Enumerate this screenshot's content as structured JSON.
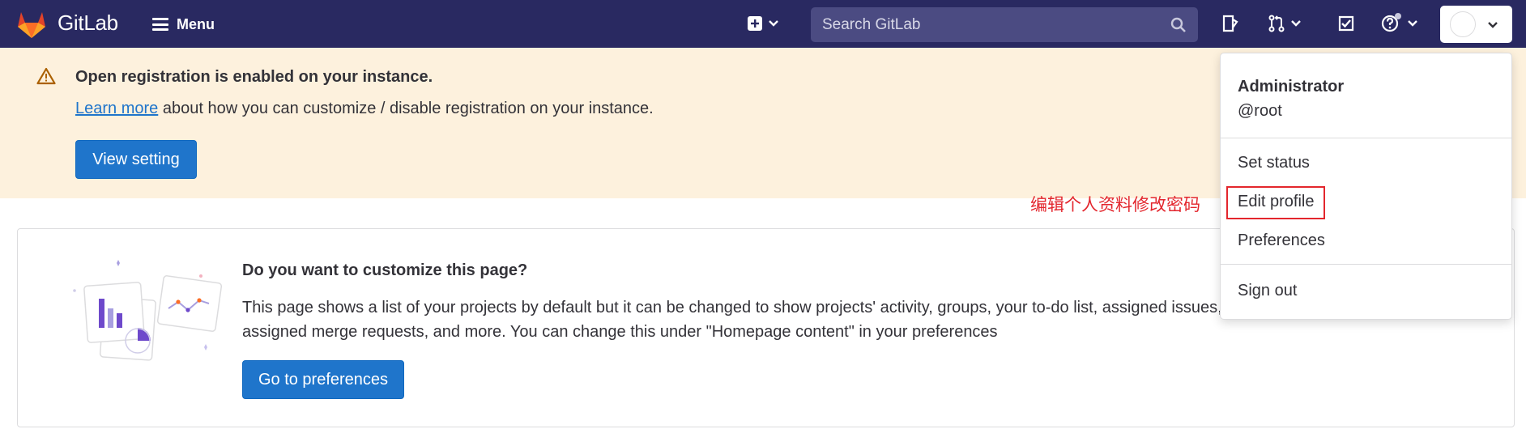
{
  "navbar": {
    "brand": "GitLab",
    "menu_label": "Menu",
    "search_placeholder": "Search GitLab"
  },
  "banner": {
    "title": "Open registration is enabled on your instance.",
    "learn_more_link": "Learn more",
    "text_rest": " about how you can customize / disable registration on your instance.",
    "button_label": "View setting"
  },
  "card": {
    "title": "Do you want to customize this page?",
    "text": "This page shows a list of your projects by default but it can be changed to show projects' activity, groups, your to-do list, assigned issues, assigned merge requests, and more. You can change this under \"Homepage content\" in your preferences",
    "button_label": "Go to preferences"
  },
  "annotation": "编辑个人资料修改密码",
  "user_menu": {
    "name": "Administrator",
    "username": "@root",
    "items": [
      "Set status",
      "Edit profile",
      "Preferences",
      "Sign out"
    ]
  },
  "colors": {
    "navbar_bg": "#292961",
    "banner_bg": "#fdf1dd",
    "primary": "#1f75cb",
    "annotation_red": "#e3262d"
  },
  "icons": [
    "gitlab-logo-icon",
    "hamburger-icon",
    "plus-square-icon",
    "chevron-down-icon",
    "search-icon",
    "issues-icon",
    "merge-request-icon",
    "todo-icon",
    "help-icon",
    "warning-icon"
  ]
}
